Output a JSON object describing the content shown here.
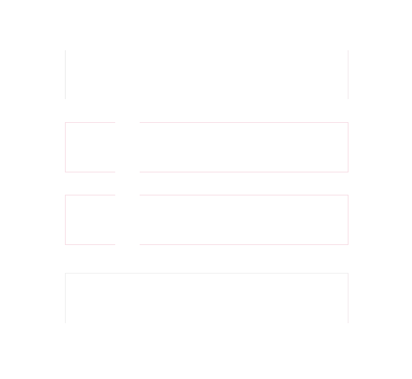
{
  "layout_panels": {
    "top_label": "",
    "row_1_label": "",
    "row_2_label": "",
    "bottom_label": ""
  },
  "colors": {
    "background": "#ffffff",
    "outline_pink": "#f6dbe3",
    "outline_grey": "#e9e9e9"
  }
}
